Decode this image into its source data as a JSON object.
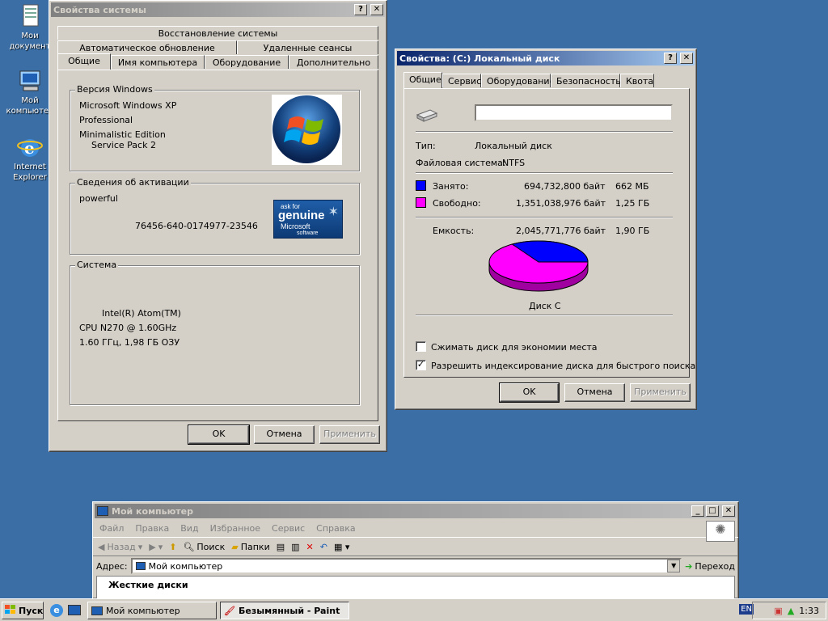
{
  "desktop": {
    "icons": [
      {
        "label": "Мои документ",
        "icon": "my-documents-icon"
      },
      {
        "label": "Мой компьютер",
        "icon": "my-computer-icon"
      },
      {
        "label": "Internet Explorer",
        "icon": "internet-explorer-icon"
      }
    ]
  },
  "sysprops": {
    "title": "Свойства системы",
    "tabs_row1": [
      "Восстановление системы"
    ],
    "tabs_row2": [
      "Автоматическое обновление",
      "Удаленные сеансы"
    ],
    "tabs_row3": [
      "Общие",
      "Имя компьютера",
      "Оборудование",
      "Дополнительно"
    ],
    "version_group": "Версия Windows",
    "version_lines": [
      "Microsoft Windows XP",
      "Professional",
      "Minimalistic  Edition",
      "Service Pack 2"
    ],
    "activation_group": "Сведения об активации",
    "registered_to": "powerful",
    "product_id": "76456-640-0174977-23546",
    "genuine_small": "ask for",
    "genuine_big": "genuine",
    "genuine_ms": "Microsoft",
    "genuine_sw": "software",
    "system_group": "Система",
    "system_lines": [
      "Intel(R) Atom(TM)",
      "CPU N270   @ 1.60GHz",
      "1.60 ГГц, 1,98 ГБ ОЗУ"
    ],
    "ok": "OK",
    "cancel": "Отмена",
    "apply": "Применить"
  },
  "diskprops": {
    "title": "Свойства: (C:) Локальный диск",
    "tabs": [
      "Общие",
      "Сервис",
      "Оборудование",
      "Безопасность",
      "Квота"
    ],
    "label_value": "",
    "type_label": "Тип:",
    "type_value": "Локальный диск",
    "fs_label": "Файловая система:",
    "fs_value": "NTFS",
    "used_label": "Занято:",
    "used_bytes": "694,732,800 байт",
    "used_human": "662 МБ",
    "free_label": "Свободно:",
    "free_bytes": "1,351,038,976 байт",
    "free_human": "1,25 ГБ",
    "capacity_label": "Емкость:",
    "capacity_bytes": "2,045,771,776 байт",
    "capacity_human": "1,90 ГБ",
    "disk_label": "Диск C",
    "compress_label": "Сжимать диск для экономии места",
    "compress_checked": false,
    "index_label": "Разрешить индексирование диска для быстрого поиска",
    "index_checked": true,
    "used_fraction": 0.3396,
    "used_color": "#0000ff",
    "free_color": "#ff00ff",
    "ok": "OK",
    "cancel": "Отмена",
    "apply": "Применить"
  },
  "explorer": {
    "title": "Мой компьютер",
    "menu": [
      "Файл",
      "Правка",
      "Вид",
      "Избранное",
      "Сервис",
      "Справка"
    ],
    "back": "Назад",
    "search": "Поиск",
    "folders": "Папки",
    "address_label": "Адрес:",
    "address_value": "Мой компьютер",
    "go": "Переход",
    "section": "Жесткие диски"
  },
  "taskbar": {
    "start": "Пуск",
    "tasks": [
      "Мой компьютер",
      "Безымянный - Paint"
    ],
    "lang": "EN",
    "clock": "1:33"
  }
}
